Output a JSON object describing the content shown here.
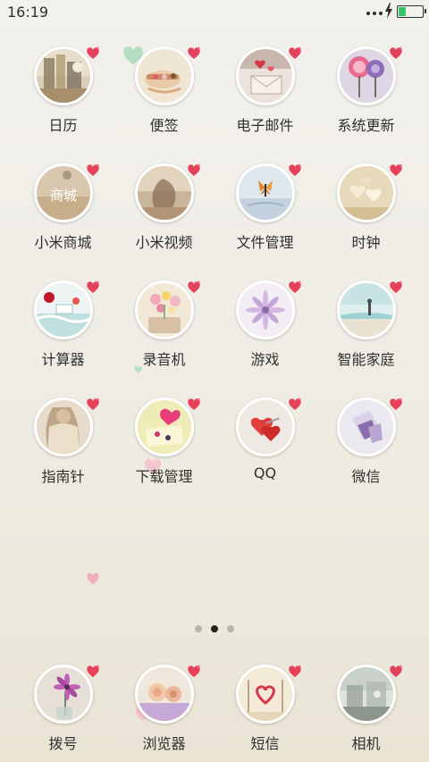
{
  "status_bar": {
    "time": "16:19",
    "battery_level": 0.28,
    "battery_color": "#39c26a",
    "charging_icon": "lightning-icon"
  },
  "home_apps": [
    {
      "label": "日历",
      "icon": "calendar-icon"
    },
    {
      "label": "便签",
      "icon": "notes-icon"
    },
    {
      "label": "电子邮件",
      "icon": "email-icon"
    },
    {
      "label": "系统更新",
      "icon": "system-update-icon"
    },
    {
      "label": "小米商城",
      "icon": "store-icon",
      "icon_text": "商城"
    },
    {
      "label": "小米视频",
      "icon": "video-icon"
    },
    {
      "label": "文件管理",
      "icon": "file-manager-icon"
    },
    {
      "label": "时钟",
      "icon": "clock-icon"
    },
    {
      "label": "计算器",
      "icon": "calculator-icon"
    },
    {
      "label": "录音机",
      "icon": "recorder-icon"
    },
    {
      "label": "游戏",
      "icon": "games-icon"
    },
    {
      "label": "智能家庭",
      "icon": "smart-home-icon"
    },
    {
      "label": "指南针",
      "icon": "compass-icon"
    },
    {
      "label": "下载管理",
      "icon": "download-manager-icon"
    },
    {
      "label": "QQ",
      "icon": "qq-icon"
    },
    {
      "label": "微信",
      "icon": "wechat-icon"
    }
  ],
  "dock_apps": [
    {
      "label": "拨号",
      "icon": "dialer-icon"
    },
    {
      "label": "浏览器",
      "icon": "browser-icon"
    },
    {
      "label": "短信",
      "icon": "messages-icon"
    },
    {
      "label": "相机",
      "icon": "camera-icon"
    }
  ],
  "page_indicator": {
    "total": 3,
    "current": 2
  },
  "colors": {
    "badge_heart": "#e6415a",
    "active_dot": "#222222",
    "inactive_dot": "#b6b3ab"
  }
}
